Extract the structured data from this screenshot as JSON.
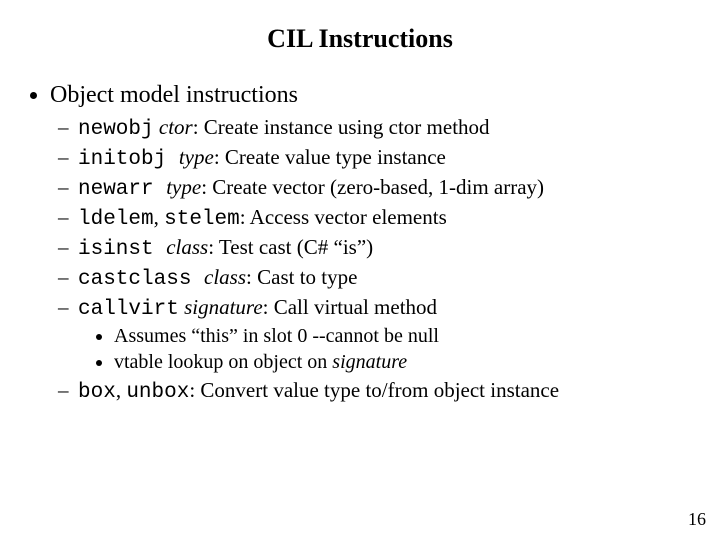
{
  "title": "CIL Instructions",
  "heading": "Object model instructions",
  "items": [
    {
      "code": "newobj",
      "arg": "ctor",
      "desc": ": Create instance using ctor method"
    },
    {
      "code": "initobj ",
      "arg": "type",
      "desc": ": Create value type instance"
    },
    {
      "code": "newarr ",
      "arg": "type",
      "desc": ": Create vector (zero-based, 1-dim array)"
    },
    {
      "code": "ldelem",
      "mid": ", ",
      "code2": "stelem",
      "desc": ": Access vector elements"
    },
    {
      "code": "isinst ",
      "arg": "class",
      "desc": ": Test cast (C# “is”)"
    },
    {
      "code": "castclass ",
      "arg": "class",
      "desc": ": Cast to type"
    },
    {
      "code": "callvirt",
      "arg": "signature",
      "desc": ": Call virtual method"
    }
  ],
  "subnotes": {
    "a_pre": "Assumes “this” in slot 0 --cannot be null",
    "b_pre": "vtable lookup on object on ",
    "b_ital": "signature"
  },
  "lastitem": {
    "code1": "box",
    "mid": ", ",
    "code2": "unbox",
    "desc": ": Convert value type to/from object instance"
  },
  "pagenum": "16"
}
